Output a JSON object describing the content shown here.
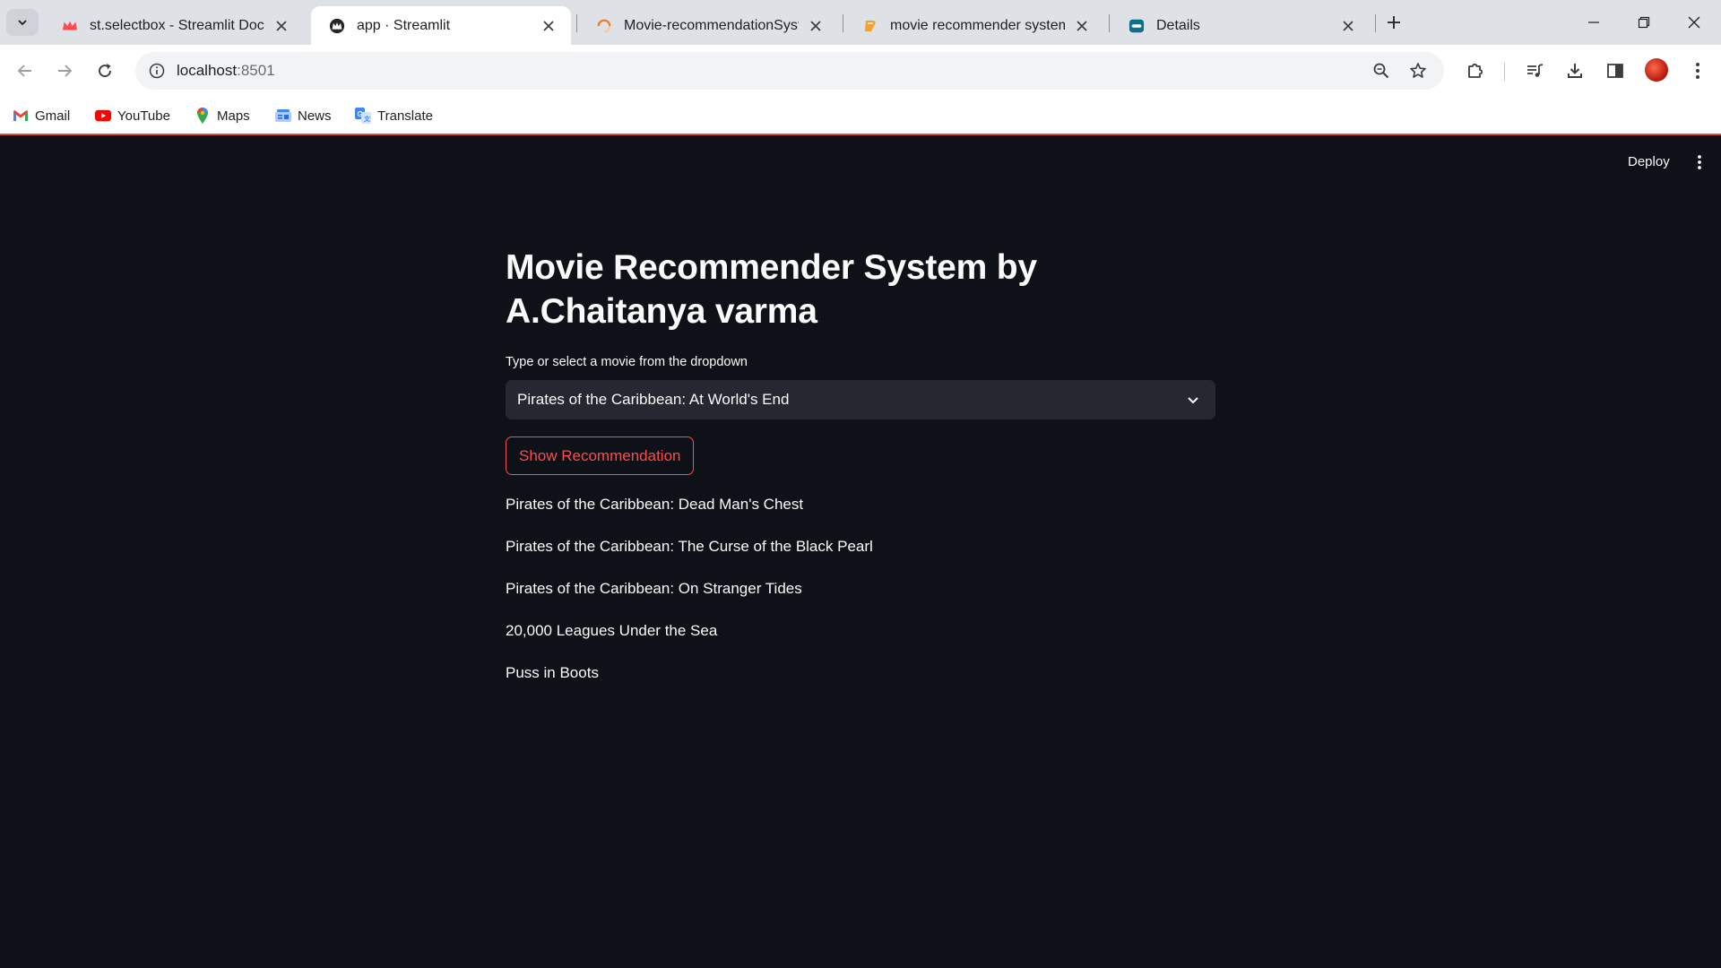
{
  "browser": {
    "tabs": [
      {
        "title": "st.selectbox - Streamlit Docs",
        "favicon": "streamlit-crown-icon",
        "active": false
      },
      {
        "title": "app · Streamlit",
        "favicon": "streamlit-dark-crown-icon",
        "active": true
      },
      {
        "title": "Movie-recommendationSystem",
        "favicon": "jupyter-loading-icon",
        "active": false
      },
      {
        "title": "movie recommender system - J",
        "favicon": "orange-notebook-icon",
        "active": false
      },
      {
        "title": "Details",
        "favicon": "details-app-icon",
        "active": false
      }
    ],
    "url_host": "localhost",
    "url_port": ":8501",
    "bookmarks": [
      {
        "label": "Gmail",
        "icon": "gmail-icon"
      },
      {
        "label": "YouTube",
        "icon": "youtube-icon"
      },
      {
        "label": "Maps",
        "icon": "maps-icon"
      },
      {
        "label": "News",
        "icon": "news-icon"
      },
      {
        "label": "Translate",
        "icon": "translate-icon"
      }
    ],
    "accent_color": "#ff4b4b"
  },
  "app": {
    "header": {
      "deploy_label": "Deploy"
    },
    "title": "Movie Recommender System by A.Chaitanya varma",
    "select": {
      "label": "Type or select a movie from the dropdown",
      "value": "Pirates of the Caribbean: At World's End"
    },
    "button_label": "Show Recommendation",
    "recommendations": [
      "Pirates of the Caribbean: Dead Man's Chest",
      "Pirates of the Caribbean: The Curse of the Black Pearl",
      "Pirates of the Caribbean: On Stranger Tides",
      "20,000 Leagues Under the Sea",
      "Puss in Boots"
    ]
  }
}
